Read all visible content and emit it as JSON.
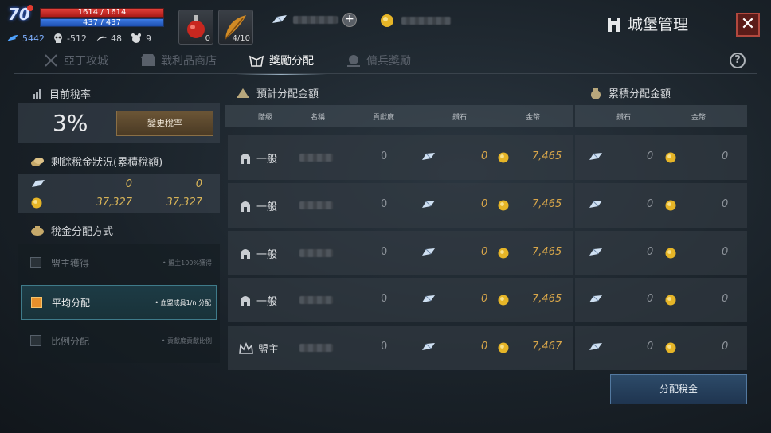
{
  "player": {
    "level": "70",
    "hp_text": "1614 / 1614",
    "hp_fraction": 1.0,
    "mp_text": "437 / 437",
    "mp_fraction": 1.0,
    "stat_wing": "5442",
    "stat_skull": "-512",
    "stat_moon": "48",
    "stat_critter": "9"
  },
  "items": {
    "potion_count": "0",
    "feather_count": "4/10"
  },
  "window": {
    "title": "城堡管理",
    "close_icon": "close-icon",
    "help_icon": "?"
  },
  "tabs": [
    {
      "label": "亞丁攻城",
      "icon": "crossed-axes-icon"
    },
    {
      "label": "戰利品商店",
      "icon": "store-icon"
    },
    {
      "label": "獎勵分配",
      "icon": "reward-icon"
    },
    {
      "label": "傭兵獎勵",
      "icon": "mercenary-icon"
    }
  ],
  "left": {
    "tax_title": "目前稅率",
    "tax_rate": "3%",
    "change_button": "變更稅率",
    "remain_title": "剩餘稅金狀況(累積稅額)",
    "remain_diamond_1": "0",
    "remain_diamond_2": "0",
    "remain_gold_1": "37,327",
    "remain_gold_2": "37,327",
    "method_title": "稅金分配方式",
    "options": [
      {
        "label": "盟主獲得",
        "desc": "• 盟主100%獲得"
      },
      {
        "label": "平均分配",
        "desc": "• 血盟成員1/n 分配"
      },
      {
        "label": "比例分配",
        "desc": "• 貢獻度貢獻比例"
      }
    ]
  },
  "table": {
    "expected_title": "預計分配金額",
    "accum_title": "累積分配金額",
    "headers": {
      "grade": "階級",
      "name": "名稱",
      "contribution": "貢獻度",
      "diamond": "鑽石",
      "gold": "金幣",
      "acc_diamond": "鑽石",
      "acc_gold": "金幣"
    },
    "rows": [
      {
        "grade": "一般",
        "contribution": "0",
        "diamond": "0",
        "gold": "7,465",
        "acc_diamond": "0",
        "acc_gold": "0",
        "crown": false
      },
      {
        "grade": "一般",
        "contribution": "0",
        "diamond": "0",
        "gold": "7,465",
        "acc_diamond": "0",
        "acc_gold": "0",
        "crown": false
      },
      {
        "grade": "一般",
        "contribution": "0",
        "diamond": "0",
        "gold": "7,465",
        "acc_diamond": "0",
        "acc_gold": "0",
        "crown": false
      },
      {
        "grade": "一般",
        "contribution": "0",
        "diamond": "0",
        "gold": "7,465",
        "acc_diamond": "0",
        "acc_gold": "0",
        "crown": false
      },
      {
        "grade": "盟主",
        "contribution": "0",
        "diamond": "0",
        "gold": "7,467",
        "acc_diamond": "0",
        "acc_gold": "0",
        "crown": true
      }
    ]
  },
  "distribute_button": "分配稅金",
  "colors": {
    "gold_text": "#d8a64a",
    "selected_option": "#3f7b8a",
    "close_button": "#b2483e"
  }
}
